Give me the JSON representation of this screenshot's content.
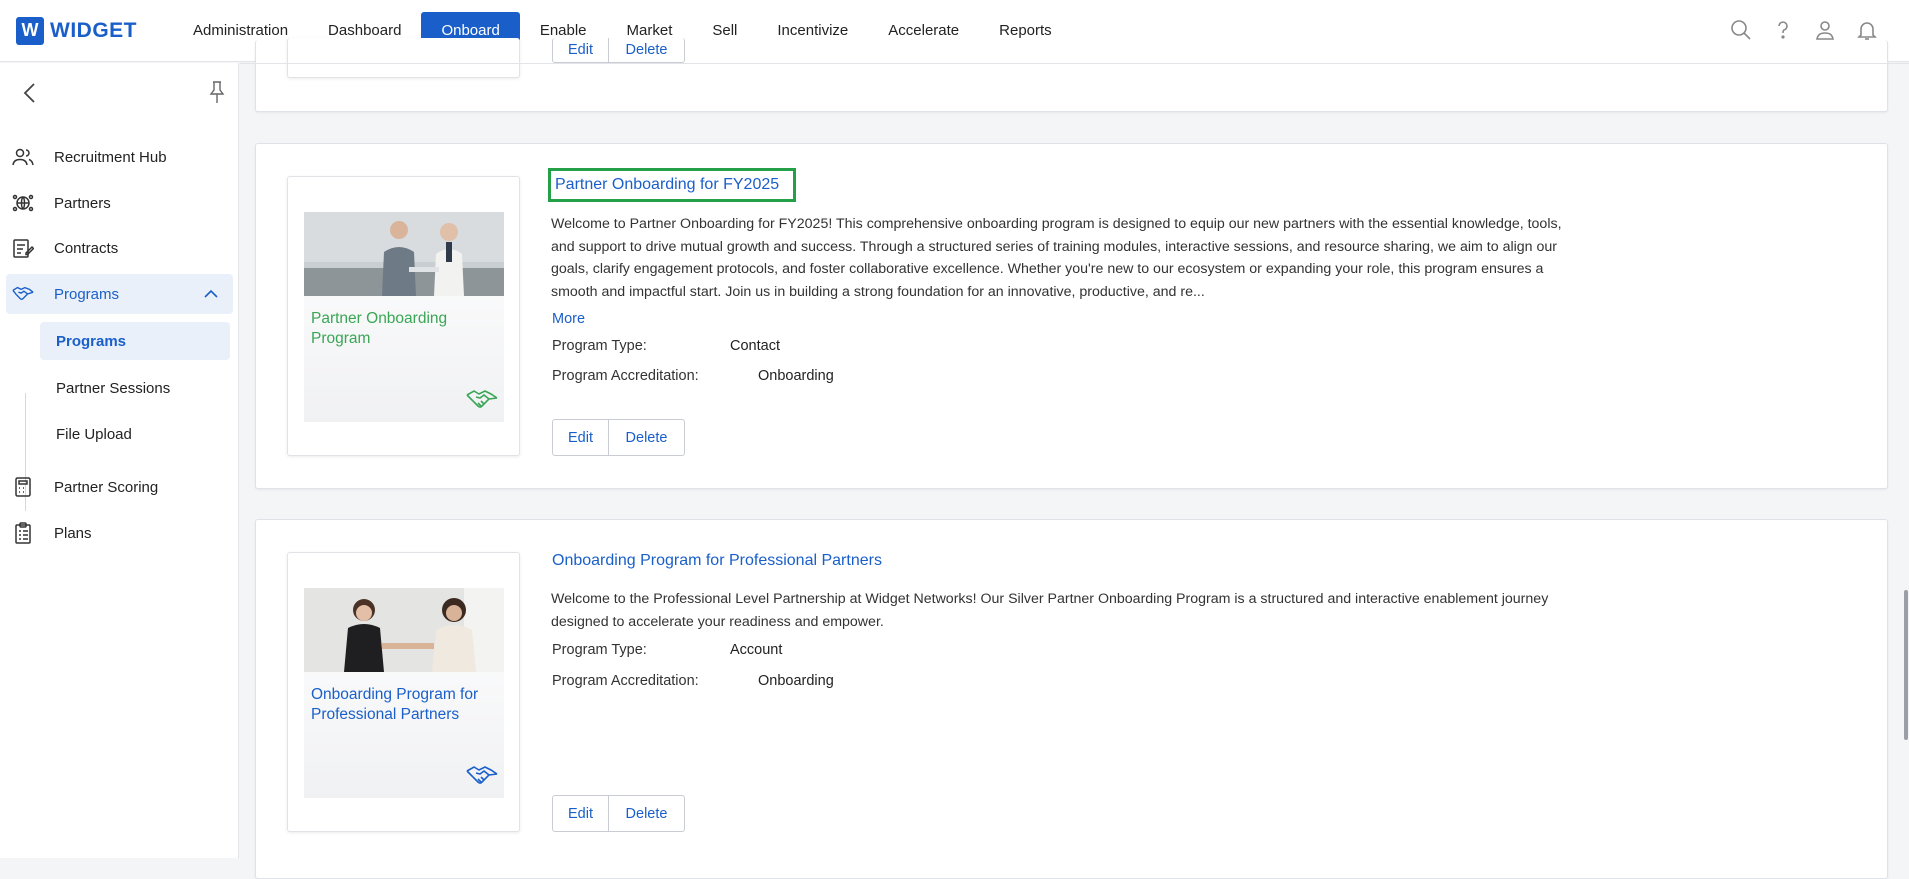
{
  "header": {
    "logo_letter": "W",
    "logo_text": "WIDGET",
    "nav": [
      {
        "label": "Administration"
      },
      {
        "label": "Dashboard"
      },
      {
        "label": "Onboard",
        "active": true
      },
      {
        "label": "Enable"
      },
      {
        "label": "Market"
      },
      {
        "label": "Sell"
      },
      {
        "label": "Incentivize"
      },
      {
        "label": "Accelerate"
      },
      {
        "label": "Reports"
      }
    ],
    "icons": [
      "search-icon",
      "help-icon",
      "user-icon",
      "bell-icon"
    ]
  },
  "sidebar": {
    "items": [
      {
        "label": "Recruitment Hub",
        "icon": "people-icon"
      },
      {
        "label": "Partners",
        "icon": "globe-icon"
      },
      {
        "label": "Contracts",
        "icon": "contract-icon"
      },
      {
        "label": "Programs",
        "icon": "handshake-icon",
        "expanded": true
      },
      {
        "label": "Partner Scoring",
        "icon": "calculator-icon"
      },
      {
        "label": "Plans",
        "icon": "clipboard-icon"
      }
    ],
    "subitems": [
      {
        "label": "Programs",
        "selected": true
      },
      {
        "label": "Partner Sessions"
      },
      {
        "label": "File Upload"
      }
    ]
  },
  "top_card": {
    "edit_label": "Edit",
    "delete_label": "Delete"
  },
  "programs": [
    {
      "thumb_title": "Partner Onboarding Program",
      "thumb_color": "#3aa655",
      "title": "Partner Onboarding for FY2025",
      "description": "Welcome to Partner Onboarding for FY2025! This comprehensive onboarding program is designed to equip our new partners with the essential knowledge, tools, and support to drive mutual growth and success. Through a structured series of training modules, interactive sessions, and resource sharing, we aim to align our goals, clarify engagement protocols, and foster collaborative excellence. Whether you're new to our ecosystem or expanding your role, this program ensures a smooth and impactful start. Join us in building a strong foundation for an innovative, productive, and re...",
      "more_label": "More",
      "type_label": "Program Type:",
      "type_value": "Contact",
      "accreditation_label": "Program Accreditation:",
      "accreditation_value": "Onboarding",
      "edit_label": "Edit",
      "delete_label": "Delete"
    },
    {
      "thumb_title": "Onboarding Program for Professional Partners",
      "thumb_color": "#1a5fc9",
      "title": "Onboarding Program for Professional Partners",
      "description": "Welcome to the Professional Level Partnership at Widget Networks! Our Silver Partner Onboarding Program is a structured and interactive enablement journey designed to accelerate your readiness and empower.",
      "type_label": "Program Type:",
      "type_value": "Account",
      "accreditation_label": "Program Accreditation:",
      "accreditation_value": "Onboarding",
      "edit_label": "Edit",
      "delete_label": "Delete"
    }
  ],
  "colors": {
    "accent": "#1a5fc9",
    "highlight_box": "#24a148"
  }
}
